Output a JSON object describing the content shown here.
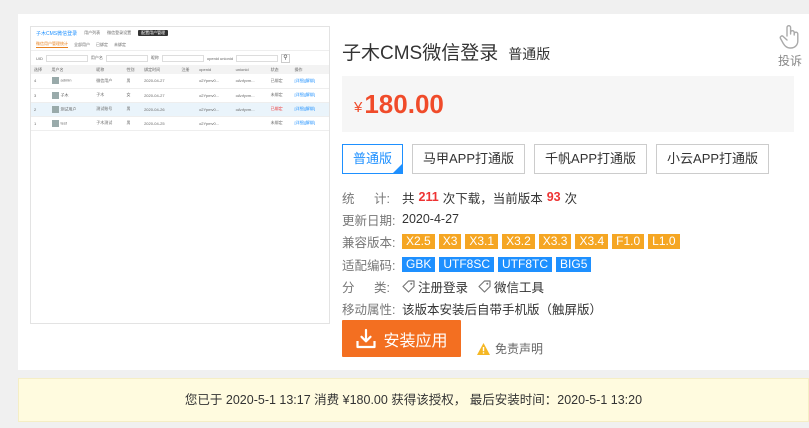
{
  "product": {
    "title": "子木CMS微信登录",
    "edition": "普通版",
    "report_label": "投诉"
  },
  "price": {
    "currency": "¥",
    "amount": "180.00"
  },
  "versions": [
    {
      "label": "普通版",
      "active": true
    },
    {
      "label": "马甲APP打通版",
      "active": false
    },
    {
      "label": "千帆APP打通版",
      "active": false
    },
    {
      "label": "小云APP打通版",
      "active": false
    }
  ],
  "meta": {
    "stats_key": [
      "统",
      "计:"
    ],
    "stats_prefix": "共",
    "downloads": "211",
    "stats_mid": "次下载，当前版本",
    "version_downloads": "93",
    "stats_suffix": "次",
    "updated_key": "更新日期:",
    "updated_value": "2020-4-27",
    "compat_key": "兼容版本:",
    "compat": [
      "X2.5",
      "X3",
      "X3.1",
      "X3.2",
      "X3.3",
      "X3.4",
      "F1.0",
      "L1.0"
    ],
    "encoding_key": "适配编码:",
    "encodings": [
      "GBK",
      "UTF8SC",
      "UTF8TC",
      "BIG5"
    ],
    "category_key": [
      "分",
      "类:"
    ],
    "categories": [
      "注册登录",
      "微信工具"
    ],
    "mobile_key": "移动属性:",
    "mobile_value": "该版本安装后自带手机版（触屏版）"
  },
  "actions": {
    "install_label": "安装应用",
    "disclaimer_label": "免责声明"
  },
  "notice": {
    "text": "您已于 2020-5-1 13:17 消费 ¥180.00 获得该授权，  最后安装时间：2020-5-1 13:20"
  },
  "preview": {
    "brand": "子木CMS微信登录",
    "nav": [
      "用户列表",
      "微信登录设置",
      "配置用户管理"
    ],
    "tabs": [
      "微信用户管理统计",
      "全部用户",
      "已绑定",
      "未绑定"
    ],
    "filter_labels": [
      "UID",
      "用户名",
      "昵称",
      "openid  unionid"
    ],
    "columns": [
      "选择",
      "用户名",
      "昵称",
      "性别",
      "绑定时间",
      "注册",
      "openid",
      "unionid",
      "状态",
      "操作"
    ],
    "rows": [
      [
        "4",
        "admin",
        "微信用户",
        "男",
        "2020-04-27",
        "",
        "o2Ypmv0...",
        "oAnfyvm...",
        "已绑定",
        "[详细][解绑]"
      ],
      [
        "3",
        "子木",
        "子木",
        "女",
        "2020-04-27",
        "",
        "o2Ypmv0...",
        "oAnfyvm...",
        "未绑定",
        "[详细][解绑]"
      ],
      [
        "2",
        "测试用户",
        "测试账号",
        "男",
        "2020-04-26",
        "",
        "o2Ypmv0...",
        "oAnfyvm...",
        "已绑定",
        "[详细][解绑]"
      ],
      [
        "1",
        "test",
        "子木测试",
        "男",
        "2020-04-25",
        "",
        "o2Ypmv0...",
        "",
        "未绑定",
        "[详细][解绑]"
      ]
    ]
  },
  "colors": {
    "accent": "#f36f21",
    "price": "#f04b2a",
    "link": "#1e90ff",
    "compat_badge": "#f5a623",
    "encoding_badge": "#1e90ff"
  }
}
